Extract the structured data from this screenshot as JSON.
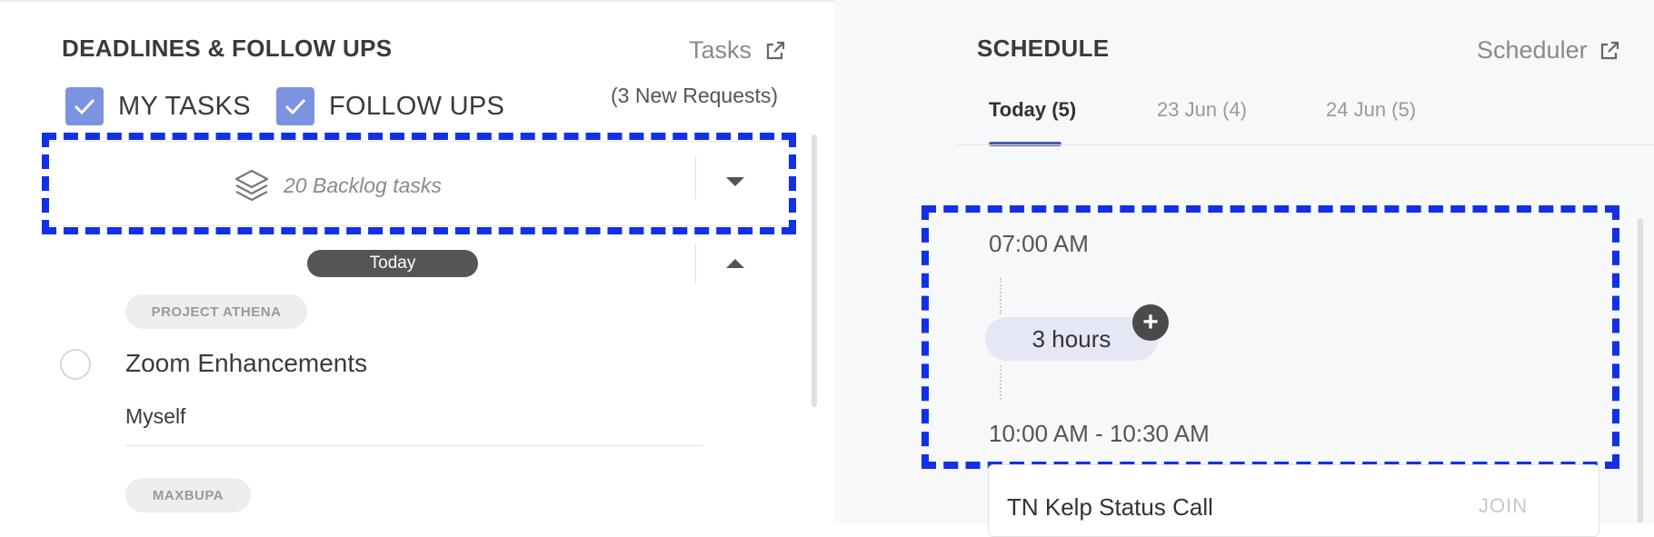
{
  "deadlines": {
    "title": "DEADLINES & FOLLOW UPS",
    "tasks_link": "Tasks",
    "new_requests": "(3 New Requests)",
    "filters": [
      {
        "label": "MY TASKS",
        "checked": true
      },
      {
        "label": "FOLLOW UPS",
        "checked": true
      }
    ],
    "backlog": "20 Backlog tasks",
    "today_badge": "Today",
    "tasks": [
      {
        "project": "PROJECT ATHENA",
        "title": "Zoom Enhancements",
        "assignee": "Myself"
      },
      {
        "project": "MAXBUPA"
      }
    ]
  },
  "schedule": {
    "title": "SCHEDULE",
    "scheduler_link": "Scheduler",
    "tabs": [
      "Today (5)",
      "23 Jun (4)",
      "24 Jun (5)"
    ],
    "active_tab": 0,
    "first_time": "07:00 AM",
    "free_block": "3 hours",
    "add_symbol": "+",
    "event_time": "10:00 AM - 10:30 AM",
    "event": {
      "title": "TN Kelp Status Call",
      "action": "JOIN"
    }
  },
  "colors": {
    "accent": "#7b93e0",
    "highlight_dash": "#1230e8",
    "tab_underline": "#4a5bb0"
  }
}
